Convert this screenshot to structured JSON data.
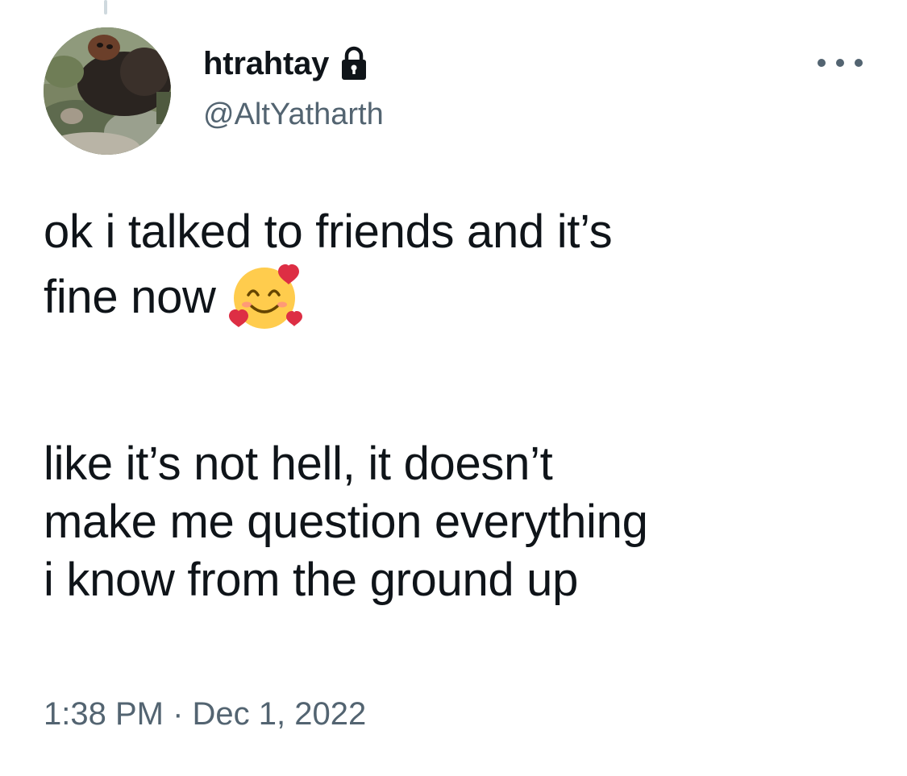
{
  "tweet": {
    "display_name": "htrahtay",
    "handle": "@AltYatharth",
    "lines": [
      "ok i talked to friends and it’s",
      "fine now",
      "like it’s not hell, it doesn’t",
      "make me question everything",
      "i know from the ground up"
    ],
    "time": "1:38 PM",
    "separator": "·",
    "date": "Dec 1, 2022"
  },
  "icons": {
    "protected": "lock-icon",
    "more": "more-options-icon",
    "emoji": "smiling-face-with-hearts-emoji"
  },
  "colors": {
    "text": "#0f1419",
    "secondary": "#536471",
    "background": "#ffffff"
  }
}
